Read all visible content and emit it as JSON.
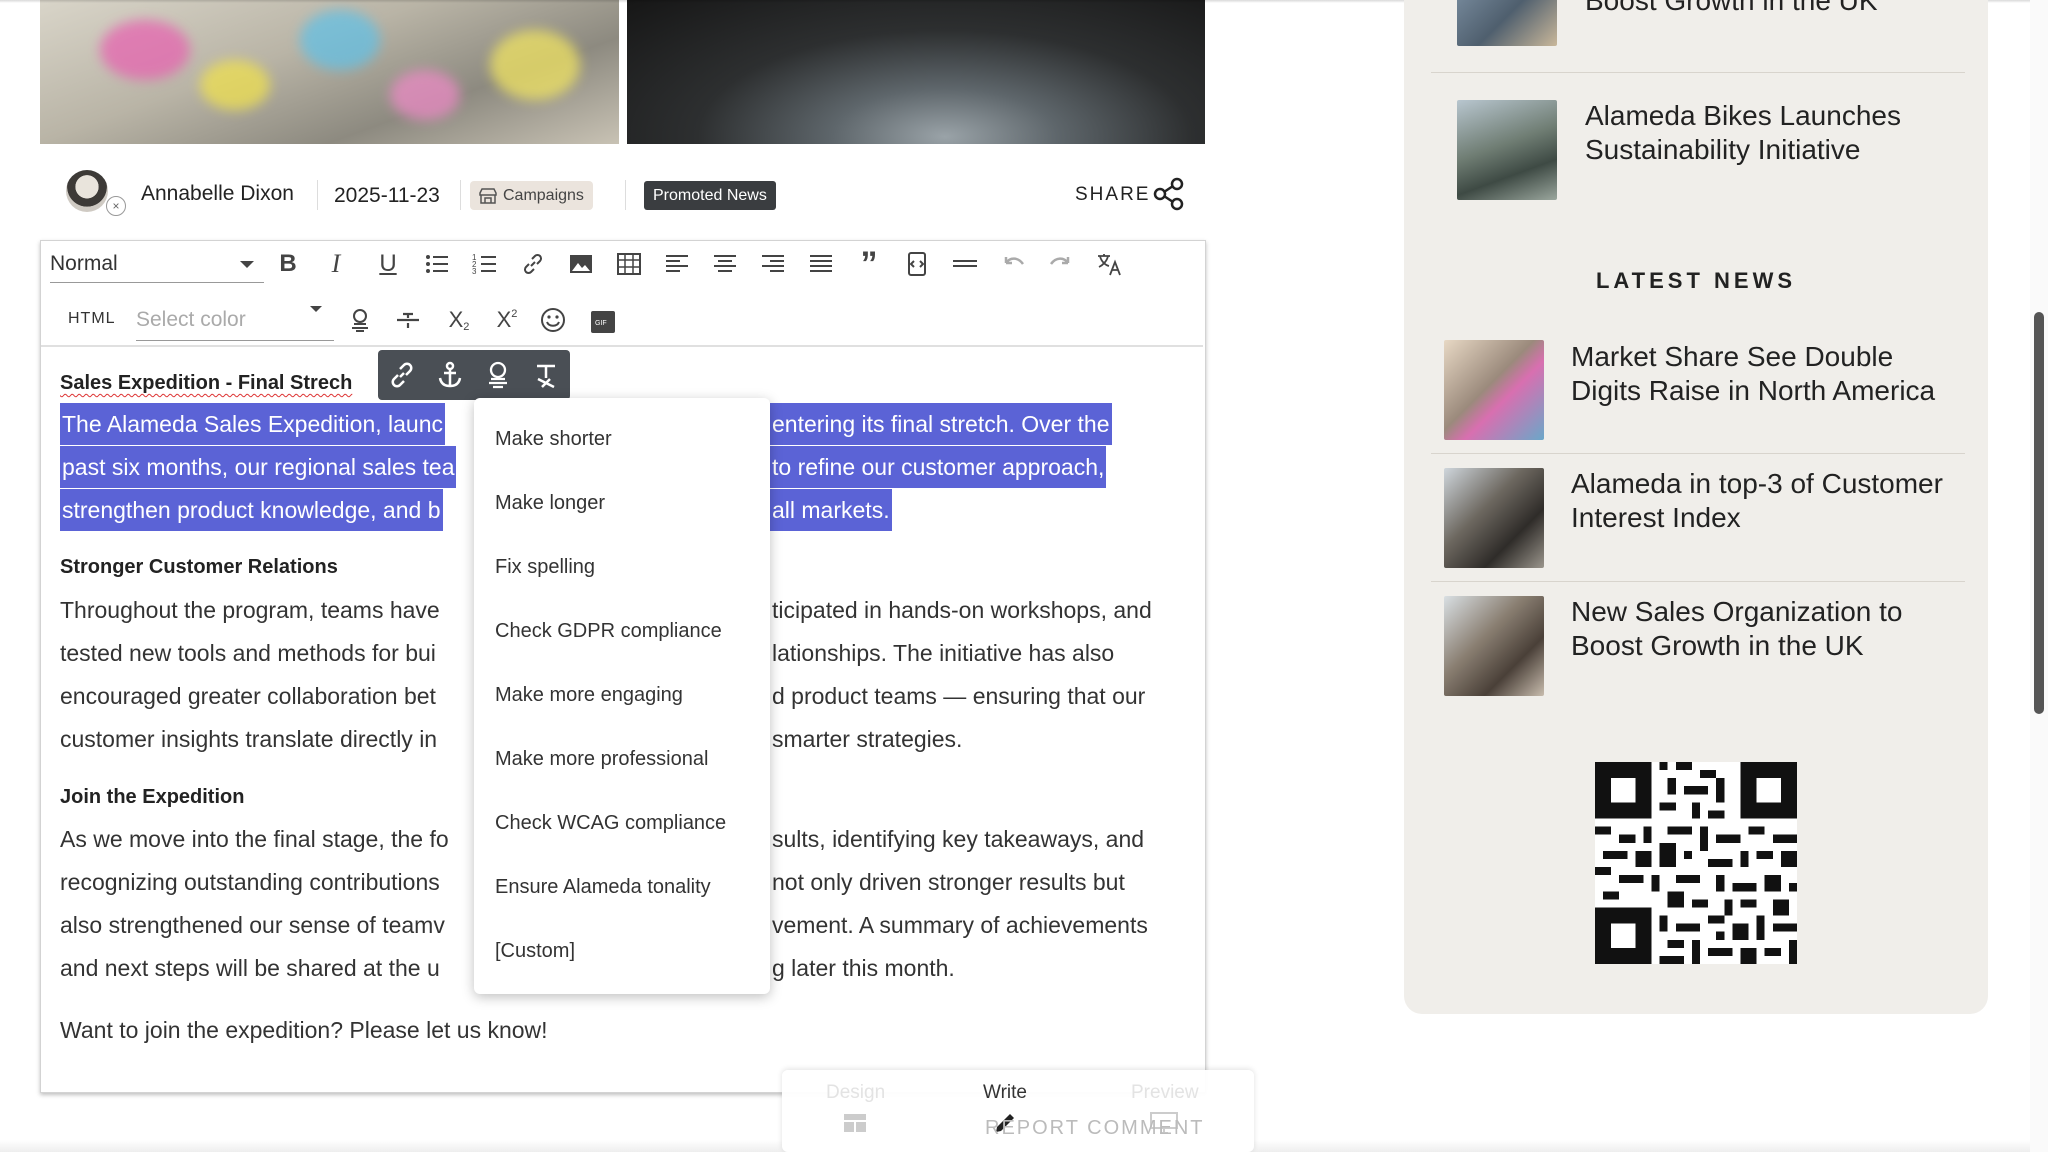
{
  "article": {
    "author": "Annabelle Dixon",
    "date": "2025-11-23",
    "category_tag": "Campaigns",
    "promo_tag": "Promoted News",
    "share_label": "SHARE"
  },
  "editor": {
    "format_value": "Normal",
    "html_label": "HTML",
    "color_placeholder": "Select color",
    "toolbar_icons": [
      "bold-icon",
      "italic-icon",
      "underline-icon",
      "bullet-list-icon",
      "numbered-list-icon",
      "link-icon",
      "image-icon",
      "table-icon",
      "align-left-icon",
      "align-center-icon",
      "align-right-icon",
      "justify-icon",
      "blockquote-icon",
      "code-block-icon",
      "horizontal-rule-icon",
      "undo-icon",
      "redo-icon",
      "translate-icon",
      "ai-assistant-icon",
      "strikethrough-icon",
      "subscript-icon",
      "superscript-icon",
      "emoji-icon",
      "gif-icon"
    ]
  },
  "content": {
    "title": "Sales Expedition - Final Strech",
    "selected_lines": [
      "The Alameda Sales Expedition, launc",
      "entering its final stretch. Over the",
      "past six months, our regional sales tea",
      "to refine our customer approach,",
      "strengthen product knowledge, and b",
      "all markets."
    ],
    "heading2": "Stronger Customer Relations",
    "para2": [
      "Throughout the program, teams have",
      "ticipated in hands-on workshops, and",
      "tested new tools and methods for bui",
      "lationships. The initiative has also",
      "encouraged greater collaboration bet",
      "d product teams — ensuring that our",
      "customer insights translate directly in",
      "smarter strategies."
    ],
    "heading3": "Join the Expedition",
    "para3": [
      "As we move into the final stage, the fo",
      "sults, identifying key takeaways, and",
      "recognizing outstanding contributions",
      "not only driven stronger results but",
      "also strengthened our sense of teamv",
      "vement. A summary of achievements",
      "and next steps will be shared at the u",
      "g later this month."
    ],
    "closing": "Want to join the expedition? Please let us know!"
  },
  "ai_menu": {
    "items": [
      "Make shorter",
      "Make longer",
      "Fix spelling",
      "Check GDPR compliance",
      "Make more engaging",
      "Make more professional",
      "Check WCAG compliance",
      "Ensure Alameda tonality",
      "[Custom]"
    ]
  },
  "bottom_nav": {
    "design": "Design",
    "write": "Write",
    "preview": "Preview",
    "report": "REPORT COMMENT"
  },
  "sidebar": {
    "top_items": [
      {
        "title": "Boost Growth in the UK"
      },
      {
        "title": "Alameda Bikes Launches Sustainability Initiative"
      }
    ],
    "latest_heading": "LATEST NEWS",
    "latest_items": [
      {
        "title": "Market Share See Double Digits Raise in North America"
      },
      {
        "title": "Alameda in top-3 of Customer Interest Index"
      },
      {
        "title": "New Sales Organization to Boost Growth in the UK"
      }
    ]
  },
  "colors": {
    "selection": "#5b63d6",
    "sidebar_bg": "#f0eeea",
    "mini_toolbar": "#4a4f55",
    "promo_tag_bg": "#3a3d40"
  }
}
